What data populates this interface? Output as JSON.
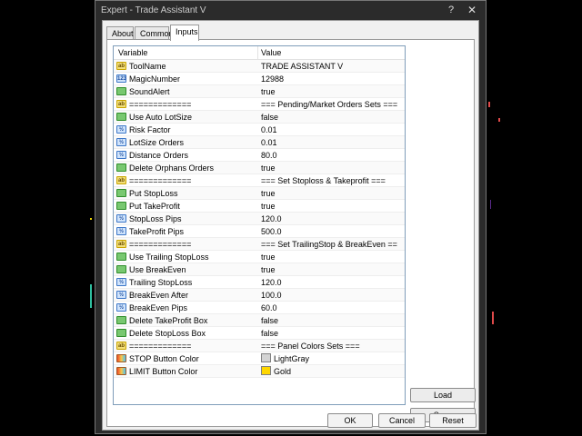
{
  "window": {
    "title": "Expert - Trade Assistant V",
    "help_label": "?",
    "close_label": "✕"
  },
  "tabs": [
    {
      "label": "About",
      "active": false
    },
    {
      "label": "Common",
      "active": false
    },
    {
      "label": "Inputs",
      "active": true
    }
  ],
  "table": {
    "columns": [
      "Variable",
      "Value"
    ],
    "rows": [
      {
        "icon": "string-icon",
        "icon_text": "ab",
        "name": "ToolName",
        "value": "TRADE ASSISTANT V"
      },
      {
        "icon": "integer-icon",
        "icon_text": "123",
        "name": "MagicNumber",
        "value": "12988"
      },
      {
        "icon": "bool-icon",
        "icon_text": "",
        "name": "SoundAlert",
        "value": "true"
      },
      {
        "icon": "string-icon",
        "icon_text": "ab",
        "name": "=============",
        "value": "=== Pending/Market Orders Sets ==="
      },
      {
        "icon": "bool-icon",
        "icon_text": "",
        "name": "Use Auto LotSize",
        "value": "false"
      },
      {
        "icon": "double-icon",
        "icon_text": "½",
        "name": "Risk Factor",
        "value": "0.01"
      },
      {
        "icon": "double-icon",
        "icon_text": "½",
        "name": "LotSize Orders",
        "value": "0.01"
      },
      {
        "icon": "double-icon",
        "icon_text": "½",
        "name": "Distance Orders",
        "value": "80.0"
      },
      {
        "icon": "bool-icon",
        "icon_text": "",
        "name": "Delete Orphans Orders",
        "value": "true"
      },
      {
        "icon": "string-icon",
        "icon_text": "ab",
        "name": "=============",
        "value": "=== Set Stoploss & Takeprofit ==="
      },
      {
        "icon": "bool-icon",
        "icon_text": "",
        "name": "Put StopLoss",
        "value": "true"
      },
      {
        "icon": "bool-icon",
        "icon_text": "",
        "name": "Put TakeProfit",
        "value": "true"
      },
      {
        "icon": "double-icon",
        "icon_text": "½",
        "name": "StopLoss Pips",
        "value": "120.0"
      },
      {
        "icon": "double-icon",
        "icon_text": "½",
        "name": "TakeProfit Pips",
        "value": "500.0"
      },
      {
        "icon": "string-icon",
        "icon_text": "ab",
        "name": "=============",
        "value": "=== Set TrailingStop & BreakEven ==="
      },
      {
        "icon": "bool-icon",
        "icon_text": "",
        "name": "Use Trailing StopLoss",
        "value": "true"
      },
      {
        "icon": "bool-icon",
        "icon_text": "",
        "name": "Use BreakEven",
        "value": "true"
      },
      {
        "icon": "double-icon",
        "icon_text": "½",
        "name": "Trailing StopLoss",
        "value": "120.0"
      },
      {
        "icon": "double-icon",
        "icon_text": "½",
        "name": "BreakEven After",
        "value": "100.0"
      },
      {
        "icon": "double-icon",
        "icon_text": "½",
        "name": "BreakEven Pips",
        "value": "60.0"
      },
      {
        "icon": "bool-icon",
        "icon_text": "",
        "name": "Delete TakeProfit Box",
        "value": "false"
      },
      {
        "icon": "bool-icon",
        "icon_text": "",
        "name": "Delete StopLoss Box",
        "value": "false"
      },
      {
        "icon": "string-icon",
        "icon_text": "ab",
        "name": "=============",
        "value": "=== Panel Colors Sets ==="
      },
      {
        "icon": "color-icon",
        "icon_text": "",
        "name": "STOP Button Color",
        "value": "LightGray",
        "swatch": "#d3d3d3"
      },
      {
        "icon": "color-icon",
        "icon_text": "",
        "name": "LIMIT Button Color",
        "value": "Gold",
        "swatch": "#ffd700"
      }
    ]
  },
  "buttons": {
    "load": "Load",
    "save": "Save",
    "ok": "OK",
    "cancel": "Cancel",
    "reset": "Reset"
  },
  "colors": {
    "chart_background": "#000000",
    "chart_candle_up": "#2fbf9f",
    "chart_candle_down": "#e04a4a",
    "chart_accent": "#e8d100"
  }
}
